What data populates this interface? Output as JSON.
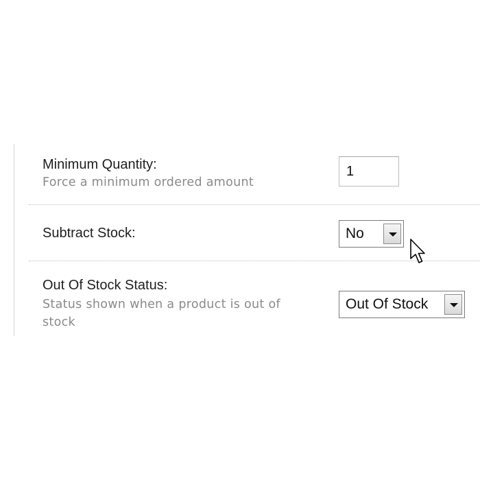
{
  "minimum_quantity": {
    "label": "Minimum Quantity:",
    "help": "Force a minimum ordered amount",
    "value": "1"
  },
  "subtract_stock": {
    "label": "Subtract Stock:",
    "selected": "No"
  },
  "out_of_stock_status": {
    "label": "Out Of Stock Status:",
    "help": "Status shown when a product is out of stock",
    "selected": "Out Of Stock"
  },
  "icons": {
    "dropdown": "chevron-down-icon",
    "pointer": "mouse-cursor-icon"
  },
  "colors": {
    "label": "#1e1e1e",
    "help": "#8a8a8a",
    "divider": "#bdbdbd"
  }
}
